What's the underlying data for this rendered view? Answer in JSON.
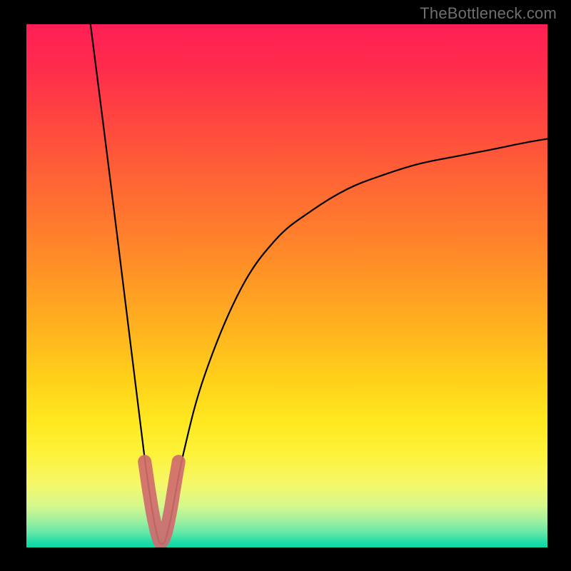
{
  "watermark": "TheBottleneck.com",
  "colors": {
    "frame_bg": "#000000",
    "curve": "#000000",
    "thick_stroke": "#cf6b6e",
    "gradient_top": "#ff1e55",
    "gradient_bottom": "#0cd8a4"
  },
  "chart_data": {
    "type": "line",
    "title": "",
    "xlabel": "",
    "ylabel": "",
    "xlim": [
      0,
      100
    ],
    "ylim": [
      0,
      100
    ],
    "grid": false,
    "legend": false,
    "notes": "V-shaped bottleneck curve; axes unlabeled; y is visually inverted (high values at top). Values are read off the plotted curve (y ≈ percentage height from bottom, x ≈ percentage from left).",
    "series": [
      {
        "name": "curve",
        "x": [
          12.3,
          15.8,
          19.2,
          22.6,
          24.7,
          26.0,
          27.4,
          30.1,
          34.2,
          41.1,
          47.9,
          54.8,
          61.6,
          68.5,
          75.3,
          82.2,
          89.0,
          95.9,
          100.0
        ],
        "y": [
          100.0,
          72.6,
          45.2,
          17.8,
          4.1,
          0.7,
          4.1,
          17.8,
          32.9,
          49.3,
          58.9,
          64.4,
          68.5,
          71.2,
          73.3,
          74.7,
          76.0,
          77.4,
          78.1
        ]
      },
      {
        "name": "valley-highlight",
        "x": [
          22.7,
          23.5,
          24.3,
          25.1,
          25.8,
          26.7,
          27.6,
          28.4,
          29.2
        ],
        "y": [
          16.4,
          11.0,
          6.2,
          2.7,
          1.0,
          2.7,
          6.8,
          11.6,
          16.4
        ]
      }
    ]
  }
}
